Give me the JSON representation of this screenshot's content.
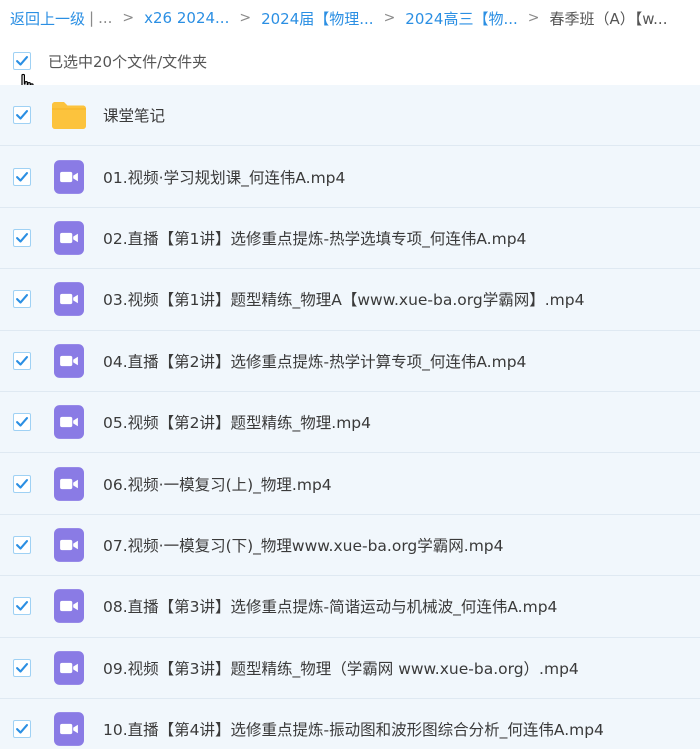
{
  "breadcrumb": {
    "back": "返回上一级",
    "separator": "|",
    "ellipsis": "...",
    "arrow": ">",
    "crumbs": [
      "x26 2024...",
      "2024届【物理...",
      "2024高三【物..."
    ],
    "current": "春季班（A）【w..."
  },
  "selection": {
    "label": "已选中20个文件/文件夹",
    "checked": true
  },
  "icons": {
    "checkbox": "checkbox-checked-icon",
    "folder": "folder-icon",
    "video": "video-file-icon",
    "cursor": "hand-pointer-icon"
  },
  "colors": {
    "link": "#2b8fe3",
    "checkmark": "#2b8fe3",
    "row_bg": "#f1f7fc",
    "video_icon": "#8a7be5",
    "folder_icon": "#fcc33d"
  },
  "files": [
    {
      "type": "folder",
      "name": "课堂笔记"
    },
    {
      "type": "video",
      "name": "01.视频·学习规划课_何连伟A.mp4"
    },
    {
      "type": "video",
      "name": "02.直播【第1讲】选修重点提炼-热学选填专项_何连伟A.mp4"
    },
    {
      "type": "video",
      "name": "03.视频【第1讲】题型精练_物理A【www.xue-ba.org学霸网】.mp4"
    },
    {
      "type": "video",
      "name": "04.直播【第2讲】选修重点提炼-热学计算专项_何连伟A.mp4"
    },
    {
      "type": "video",
      "name": "05.视频【第2讲】题型精练_物理.mp4"
    },
    {
      "type": "video",
      "name": "06.视频·一模复习(上)_物理.mp4"
    },
    {
      "type": "video",
      "name": "07.视频·一模复习(下)_物理www.xue-ba.org学霸网.mp4"
    },
    {
      "type": "video",
      "name": "08.直播【第3讲】选修重点提炼-简谐运动与机械波_何连伟A.mp4"
    },
    {
      "type": "video",
      "name": "09.视频【第3讲】题型精练_物理（学霸网 www.xue-ba.org）.mp4"
    },
    {
      "type": "video",
      "name": "10.直播【第4讲】选修重点提炼-振动图和波形图综合分析_何连伟A.mp4"
    }
  ]
}
